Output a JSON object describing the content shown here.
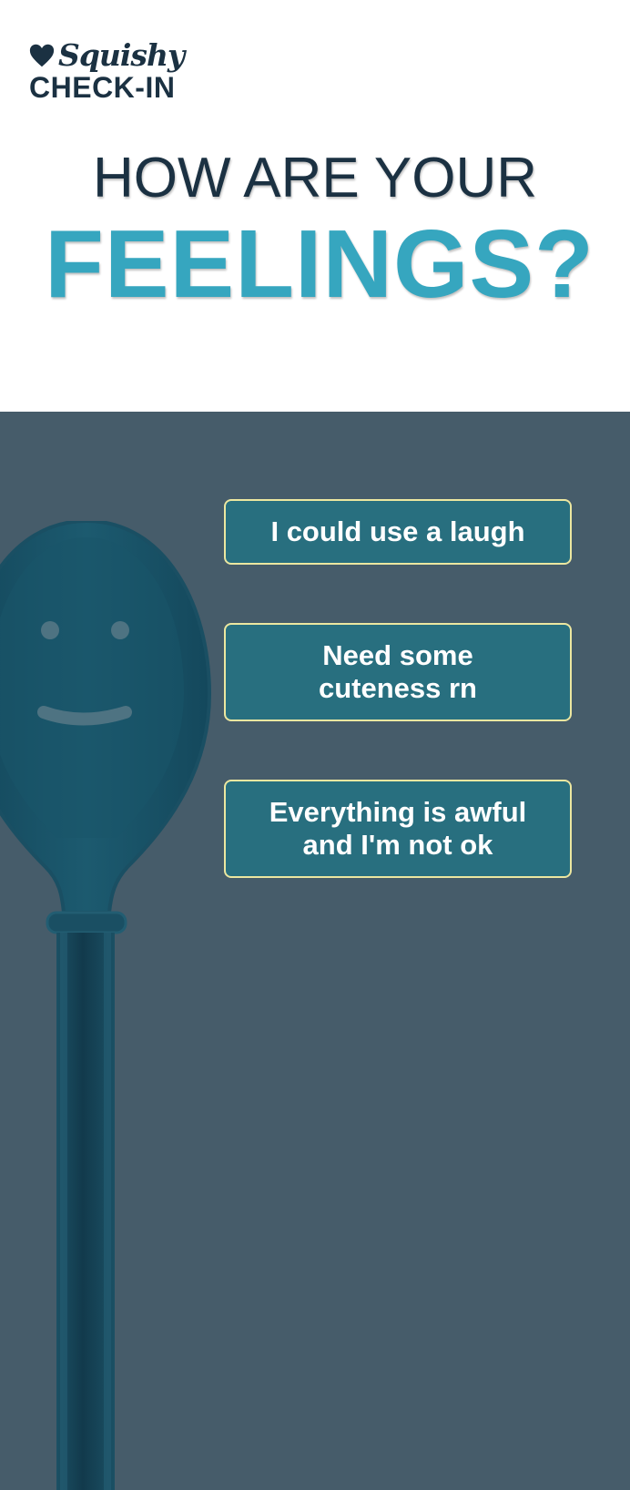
{
  "brand": {
    "script_name": "Squishy",
    "sub_name": "CHECK-IN",
    "icon": "heart-icon",
    "color": "#1b3142"
  },
  "headline": {
    "line1": "HOW ARE YOUR",
    "line2": "FEELINGS?",
    "line1_color": "#1b3142",
    "line2_color": "#36a6bf"
  },
  "options": [
    {
      "label": "I could use a laugh"
    },
    {
      "label": "Need some\ncuteness rn"
    },
    {
      "label": "Everything is awful\nand I'm not ok"
    }
  ],
  "colors": {
    "panel_bg": "#465c6a",
    "button_bg": "#286f7f",
    "button_border": "#ece7a0",
    "button_text": "#ffffff"
  },
  "illustration": {
    "icon": "smiling-spoon-illustration"
  }
}
